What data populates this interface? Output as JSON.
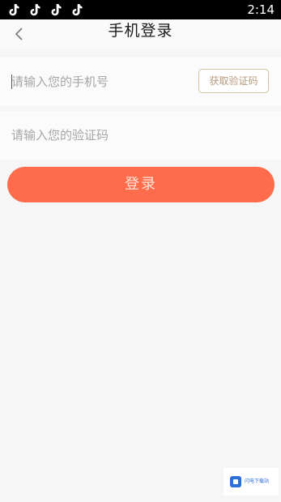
{
  "status_bar": {
    "time": "2:14",
    "notification_icons": [
      "tiktok-icon",
      "tiktok-icon",
      "tiktok-icon",
      "tiktok-icon"
    ]
  },
  "header": {
    "title": "手机登录",
    "back_icon": "chevron-left-icon"
  },
  "form": {
    "phone": {
      "value": "",
      "placeholder": "请输入您的手机号"
    },
    "get_code_label": "获取验证码",
    "code": {
      "value": "",
      "placeholder": "请输入您的验证码"
    }
  },
  "login_label": "登录",
  "watermark": {
    "text": "闪电下载站"
  },
  "colors": {
    "accent": "#ff6c4c",
    "code_button_border": "#d6bfa3",
    "code_button_text": "#b79a7e",
    "background": "#f6f6f6"
  }
}
